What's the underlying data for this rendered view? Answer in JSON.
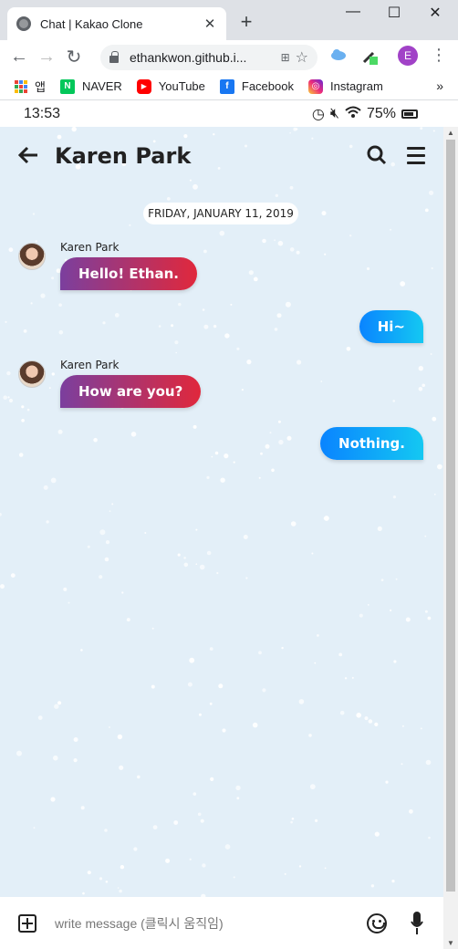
{
  "browser": {
    "tab_title": "Chat | Kakao Clone",
    "url": "ethankwon.github.i...",
    "profile_initial": "E",
    "bookmarks": [
      {
        "label": "앱",
        "icon": "apps-icon"
      },
      {
        "label": "NAVER",
        "icon": "naver-icon"
      },
      {
        "label": "YouTube",
        "icon": "youtube-icon"
      },
      {
        "label": "Facebook",
        "icon": "facebook-icon"
      },
      {
        "label": "Instagram",
        "icon": "instagram-icon"
      }
    ],
    "bookmarks_more": "»"
  },
  "status": {
    "time": "13:53",
    "battery": "75%"
  },
  "chat": {
    "title": "Karen Park",
    "date": "FRIDAY, JANUARY 11, 2019",
    "messages": [
      {
        "direction": "in",
        "sender": "Karen Park",
        "text": "Hello! Ethan."
      },
      {
        "direction": "out",
        "text": "Hi~"
      },
      {
        "direction": "in",
        "sender": "Karen Park",
        "text": "How are you?"
      },
      {
        "direction": "out",
        "text": "Nothing."
      }
    ]
  },
  "composer": {
    "placeholder": "write message (클릭시 움직임)"
  },
  "colors": {
    "incoming_gradient": [
      "#7b3f9e",
      "#e0283c"
    ],
    "outgoing_gradient": [
      "#0a84ff",
      "#14c8f2"
    ],
    "chat_background": "#e3eff8"
  }
}
